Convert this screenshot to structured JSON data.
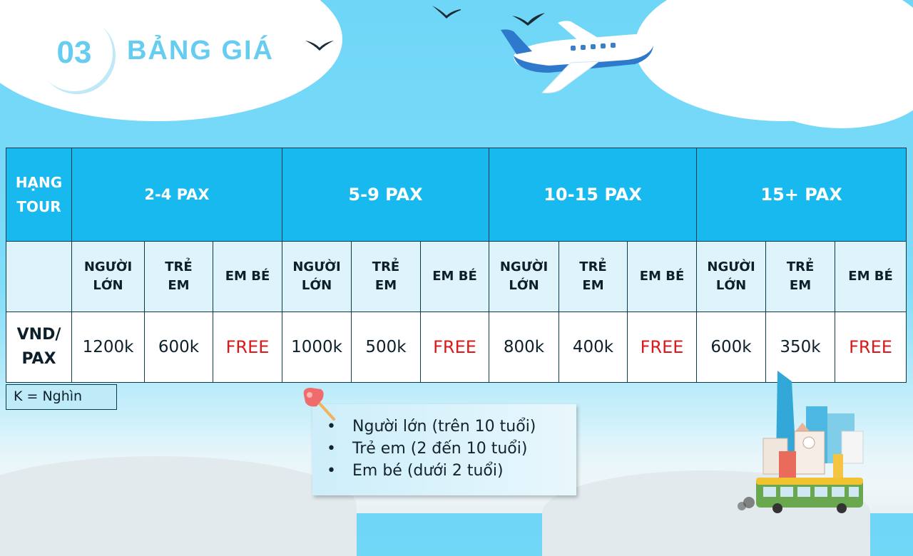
{
  "header": {
    "number": "03",
    "title": "BẢNG GIÁ"
  },
  "table": {
    "rank_label_line1": "HẠNG",
    "rank_label_line2": "TOUR",
    "groups": [
      "2-4 PAX",
      "5-9 PAX",
      "10-15 PAX",
      "15+ PAX"
    ],
    "sub_headers": [
      {
        "line1": "NGƯỜI",
        "line2": "LỚN"
      },
      {
        "line1": "TRẺ",
        "line2": "EM"
      },
      {
        "line1": "EM BÉ",
        "line2": ""
      }
    ],
    "price_label_line1": "VND/",
    "price_label_line2": "PAX",
    "prices": [
      "1200k",
      "600k",
      "FREE",
      "1000k",
      "500k",
      "FREE",
      "800k",
      "400k",
      "FREE",
      "600k",
      "350k",
      "FREE"
    ]
  },
  "note": "K = Nghìn",
  "legend": [
    "Người lớn (trên 10 tuổi)",
    "Trẻ em (2 đến 10 tuổi)",
    "Em bé (dưới 2 tuổi)"
  ],
  "legend_bullet": "•",
  "colors": {
    "header_blue": "#17b9ee",
    "free_red": "#d91a1a",
    "title_blue": "#66cdf0"
  },
  "icons": [
    "airplane-icon",
    "bird-icon",
    "pushpin-icon",
    "city-bus-icon"
  ]
}
